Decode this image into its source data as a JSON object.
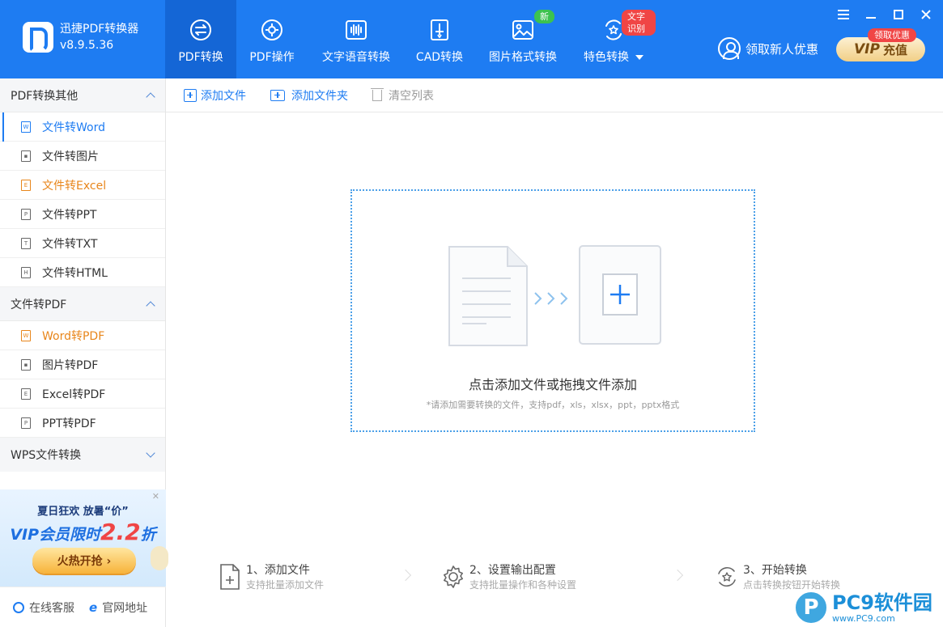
{
  "app": {
    "name": "迅捷PDF转换器",
    "version": "v8.9.5.36"
  },
  "nav": {
    "tabs": [
      {
        "label": "PDF转换",
        "icon": "swap-arrows-icon",
        "badge": ""
      },
      {
        "label": "PDF操作",
        "icon": "gear-circle-icon",
        "badge": ""
      },
      {
        "label": "文字语音转换",
        "icon": "voice-wave-icon",
        "badge": ""
      },
      {
        "label": "CAD转换",
        "icon": "cad-doc-icon",
        "badge": ""
      },
      {
        "label": "图片格式转换",
        "icon": "image-icon",
        "badge": "新"
      },
      {
        "label": "特色转换",
        "icon": "star-sync-icon",
        "badge": "文字识别"
      }
    ]
  },
  "header": {
    "new_user": "领取新人优惠",
    "vip_tag": "领取优惠",
    "vip_label": "VIP",
    "vip_recharge": "充值"
  },
  "sidebar": {
    "sections": [
      {
        "title": "PDF转换其他",
        "items": [
          {
            "label": "文件转Word",
            "icon_letter": "W"
          },
          {
            "label": "文件转图片",
            "icon_letter": ""
          },
          {
            "label": "文件转Excel",
            "icon_letter": "E"
          },
          {
            "label": "文件转PPT",
            "icon_letter": "P"
          },
          {
            "label": "文件转TXT",
            "icon_letter": "T"
          },
          {
            "label": "文件转HTML",
            "icon_letter": "H"
          }
        ]
      },
      {
        "title": "文件转PDF",
        "items": [
          {
            "label": "Word转PDF",
            "icon_letter": "W"
          },
          {
            "label": "图片转PDF",
            "icon_letter": ""
          },
          {
            "label": "Excel转PDF",
            "icon_letter": "E"
          },
          {
            "label": "PPT转PDF",
            "icon_letter": "P"
          }
        ]
      },
      {
        "title": "WPS文件转换"
      }
    ],
    "promo": {
      "line1": "夏日狂欢 放暑“价”",
      "line2_prefix": "VIP会员限时",
      "line2_number": "2.2",
      "line2_suffix": "折",
      "button": "火热开抢 ›"
    },
    "footer": {
      "support": "在线客服",
      "website": "官网地址"
    }
  },
  "toolbar": {
    "add_file": "添加文件",
    "add_folder": "添加文件夹",
    "clear_list": "清空列表"
  },
  "dropzone": {
    "title": "点击添加文件或拖拽文件添加",
    "hint": "*请添加需要转换的文件，支持pdf，xls，xlsx，ppt，pptx格式"
  },
  "steps": [
    {
      "title": "1、添加文件",
      "sub": "支持批量添加文件"
    },
    {
      "title": "2、设置输出配置",
      "sub": "支持批量操作和各种设置"
    },
    {
      "title": "3、开始转换",
      "sub": "点击转换按钮开始转换"
    }
  ],
  "watermark": {
    "mark": "P",
    "main": "PC9软件园",
    "url": "www.PC9.com"
  },
  "colors": {
    "brand_blue": "#1e7cf2",
    "active_tab": "#1466d6",
    "orange": "#e8861b",
    "badge_red": "#f04545",
    "badge_green": "#3cc24f"
  }
}
